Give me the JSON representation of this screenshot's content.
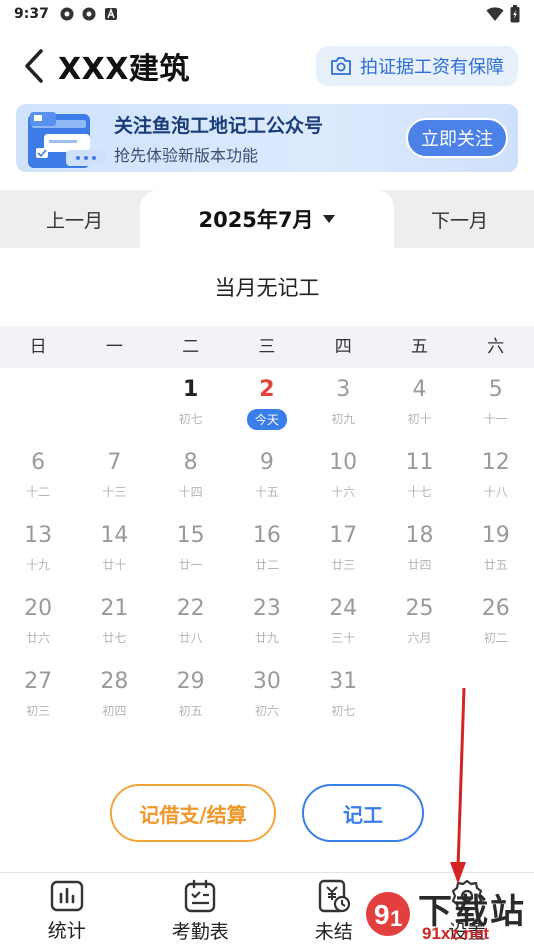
{
  "status_bar": {
    "time": "9:37",
    "icons": [
      "gear-notification-icon",
      "gear-notification-icon",
      "app-a-icon"
    ],
    "right_icons": [
      "wifi-icon",
      "battery-icon"
    ]
  },
  "header": {
    "title": "XXX建筑",
    "guarantee_label": "拍证据工资有保障",
    "back_icon": "chevron-left-icon",
    "camera_icon": "camera-icon"
  },
  "banner": {
    "title": "关注鱼泡工地记工公众号",
    "subtitle": "抢先体验新版本功能",
    "follow_label": "立即关注"
  },
  "month_nav": {
    "prev_label": "上一月",
    "current_label": "2025年7月",
    "next_label": "下一月"
  },
  "summary": {
    "text": "当月无记工"
  },
  "weekdays": [
    "日",
    "一",
    "二",
    "三",
    "四",
    "五",
    "六"
  ],
  "calendar": {
    "today_label": "今天",
    "rows": [
      [
        {
          "day": "",
          "lunar": ""
        },
        {
          "day": "",
          "lunar": ""
        },
        {
          "day": "1",
          "lunar": "初七"
        },
        {
          "day": "2",
          "lunar": ""
        },
        {
          "day": "3",
          "lunar": "初九"
        },
        {
          "day": "4",
          "lunar": "初十"
        },
        {
          "day": "5",
          "lunar": "十一"
        }
      ],
      [
        {
          "day": "6",
          "lunar": "十二"
        },
        {
          "day": "7",
          "lunar": "十三"
        },
        {
          "day": "8",
          "lunar": "十四"
        },
        {
          "day": "9",
          "lunar": "十五"
        },
        {
          "day": "10",
          "lunar": "十六"
        },
        {
          "day": "11",
          "lunar": "十七"
        },
        {
          "day": "12",
          "lunar": "十八"
        }
      ],
      [
        {
          "day": "13",
          "lunar": "十九"
        },
        {
          "day": "14",
          "lunar": "廿十"
        },
        {
          "day": "15",
          "lunar": "廿一"
        },
        {
          "day": "16",
          "lunar": "廿二"
        },
        {
          "day": "17",
          "lunar": "廿三"
        },
        {
          "day": "18",
          "lunar": "廿四"
        },
        {
          "day": "19",
          "lunar": "廿五"
        }
      ],
      [
        {
          "day": "20",
          "lunar": "廿六"
        },
        {
          "day": "21",
          "lunar": "廿七"
        },
        {
          "day": "22",
          "lunar": "廿八"
        },
        {
          "day": "23",
          "lunar": "廿九"
        },
        {
          "day": "24",
          "lunar": "三十"
        },
        {
          "day": "25",
          "lunar": "六月"
        },
        {
          "day": "26",
          "lunar": "初二"
        }
      ],
      [
        {
          "day": "27",
          "lunar": "初三"
        },
        {
          "day": "28",
          "lunar": "初四"
        },
        {
          "day": "29",
          "lunar": "初五"
        },
        {
          "day": "30",
          "lunar": "初六"
        },
        {
          "day": "31",
          "lunar": "初七"
        },
        {
          "day": "",
          "lunar": ""
        },
        {
          "day": "",
          "lunar": ""
        }
      ]
    ]
  },
  "actions": {
    "borrow_label": "记借支/结算",
    "record_label": "记工"
  },
  "bottom_nav": [
    {
      "label": "统计",
      "icon": "bar-chart-icon"
    },
    {
      "label": "考勤表",
      "icon": "checklist-icon"
    },
    {
      "label": "未结",
      "icon": "yuan-clock-icon"
    },
    {
      "label": "设置",
      "icon": "gear-icon"
    }
  ],
  "watermark": {
    "text": "下载站",
    "sub": "91xz.net"
  },
  "colors": {
    "accent_blue": "#3a7ee8",
    "today_red": "#e3443b",
    "orange": "#f0962a"
  }
}
